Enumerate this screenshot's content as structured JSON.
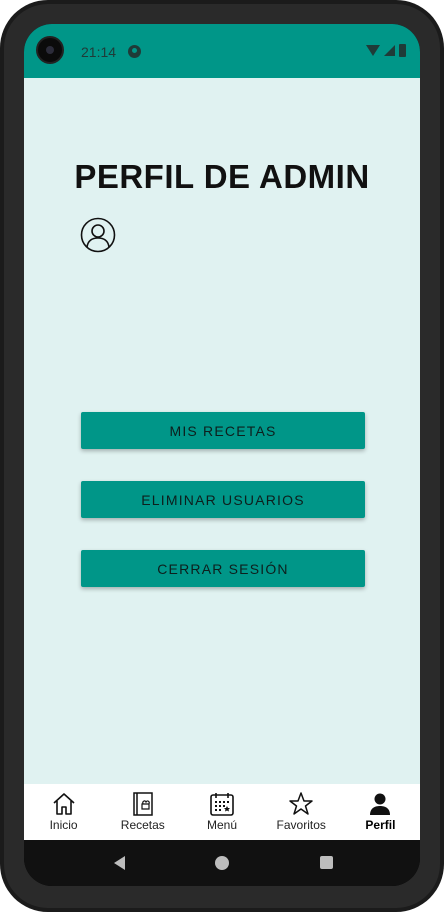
{
  "status_bar": {
    "time": "21:14",
    "icons": [
      "app-notification-icon",
      "wifi-icon",
      "signal-icon",
      "battery-icon"
    ]
  },
  "page": {
    "title": "PERFIL DE ADMIN"
  },
  "buttons": {
    "mis_recetas": "MIS RECETAS",
    "eliminar_usuarios": "ELIMINAR USUARIOS",
    "cerrar_sesion": "CERRAR SESIÓN"
  },
  "bottom_nav": {
    "items": [
      {
        "label": "Inicio",
        "icon": "home-icon"
      },
      {
        "label": "Recetas",
        "icon": "recipe-book-icon"
      },
      {
        "label": "Menú",
        "icon": "calendar-icon"
      },
      {
        "label": "Favoritos",
        "icon": "star-icon"
      },
      {
        "label": "Perfil",
        "icon": "person-icon",
        "active": true
      }
    ]
  },
  "colors": {
    "accent": "#009688",
    "background": "#e0f2f1",
    "nav_background": "#ffffff"
  }
}
